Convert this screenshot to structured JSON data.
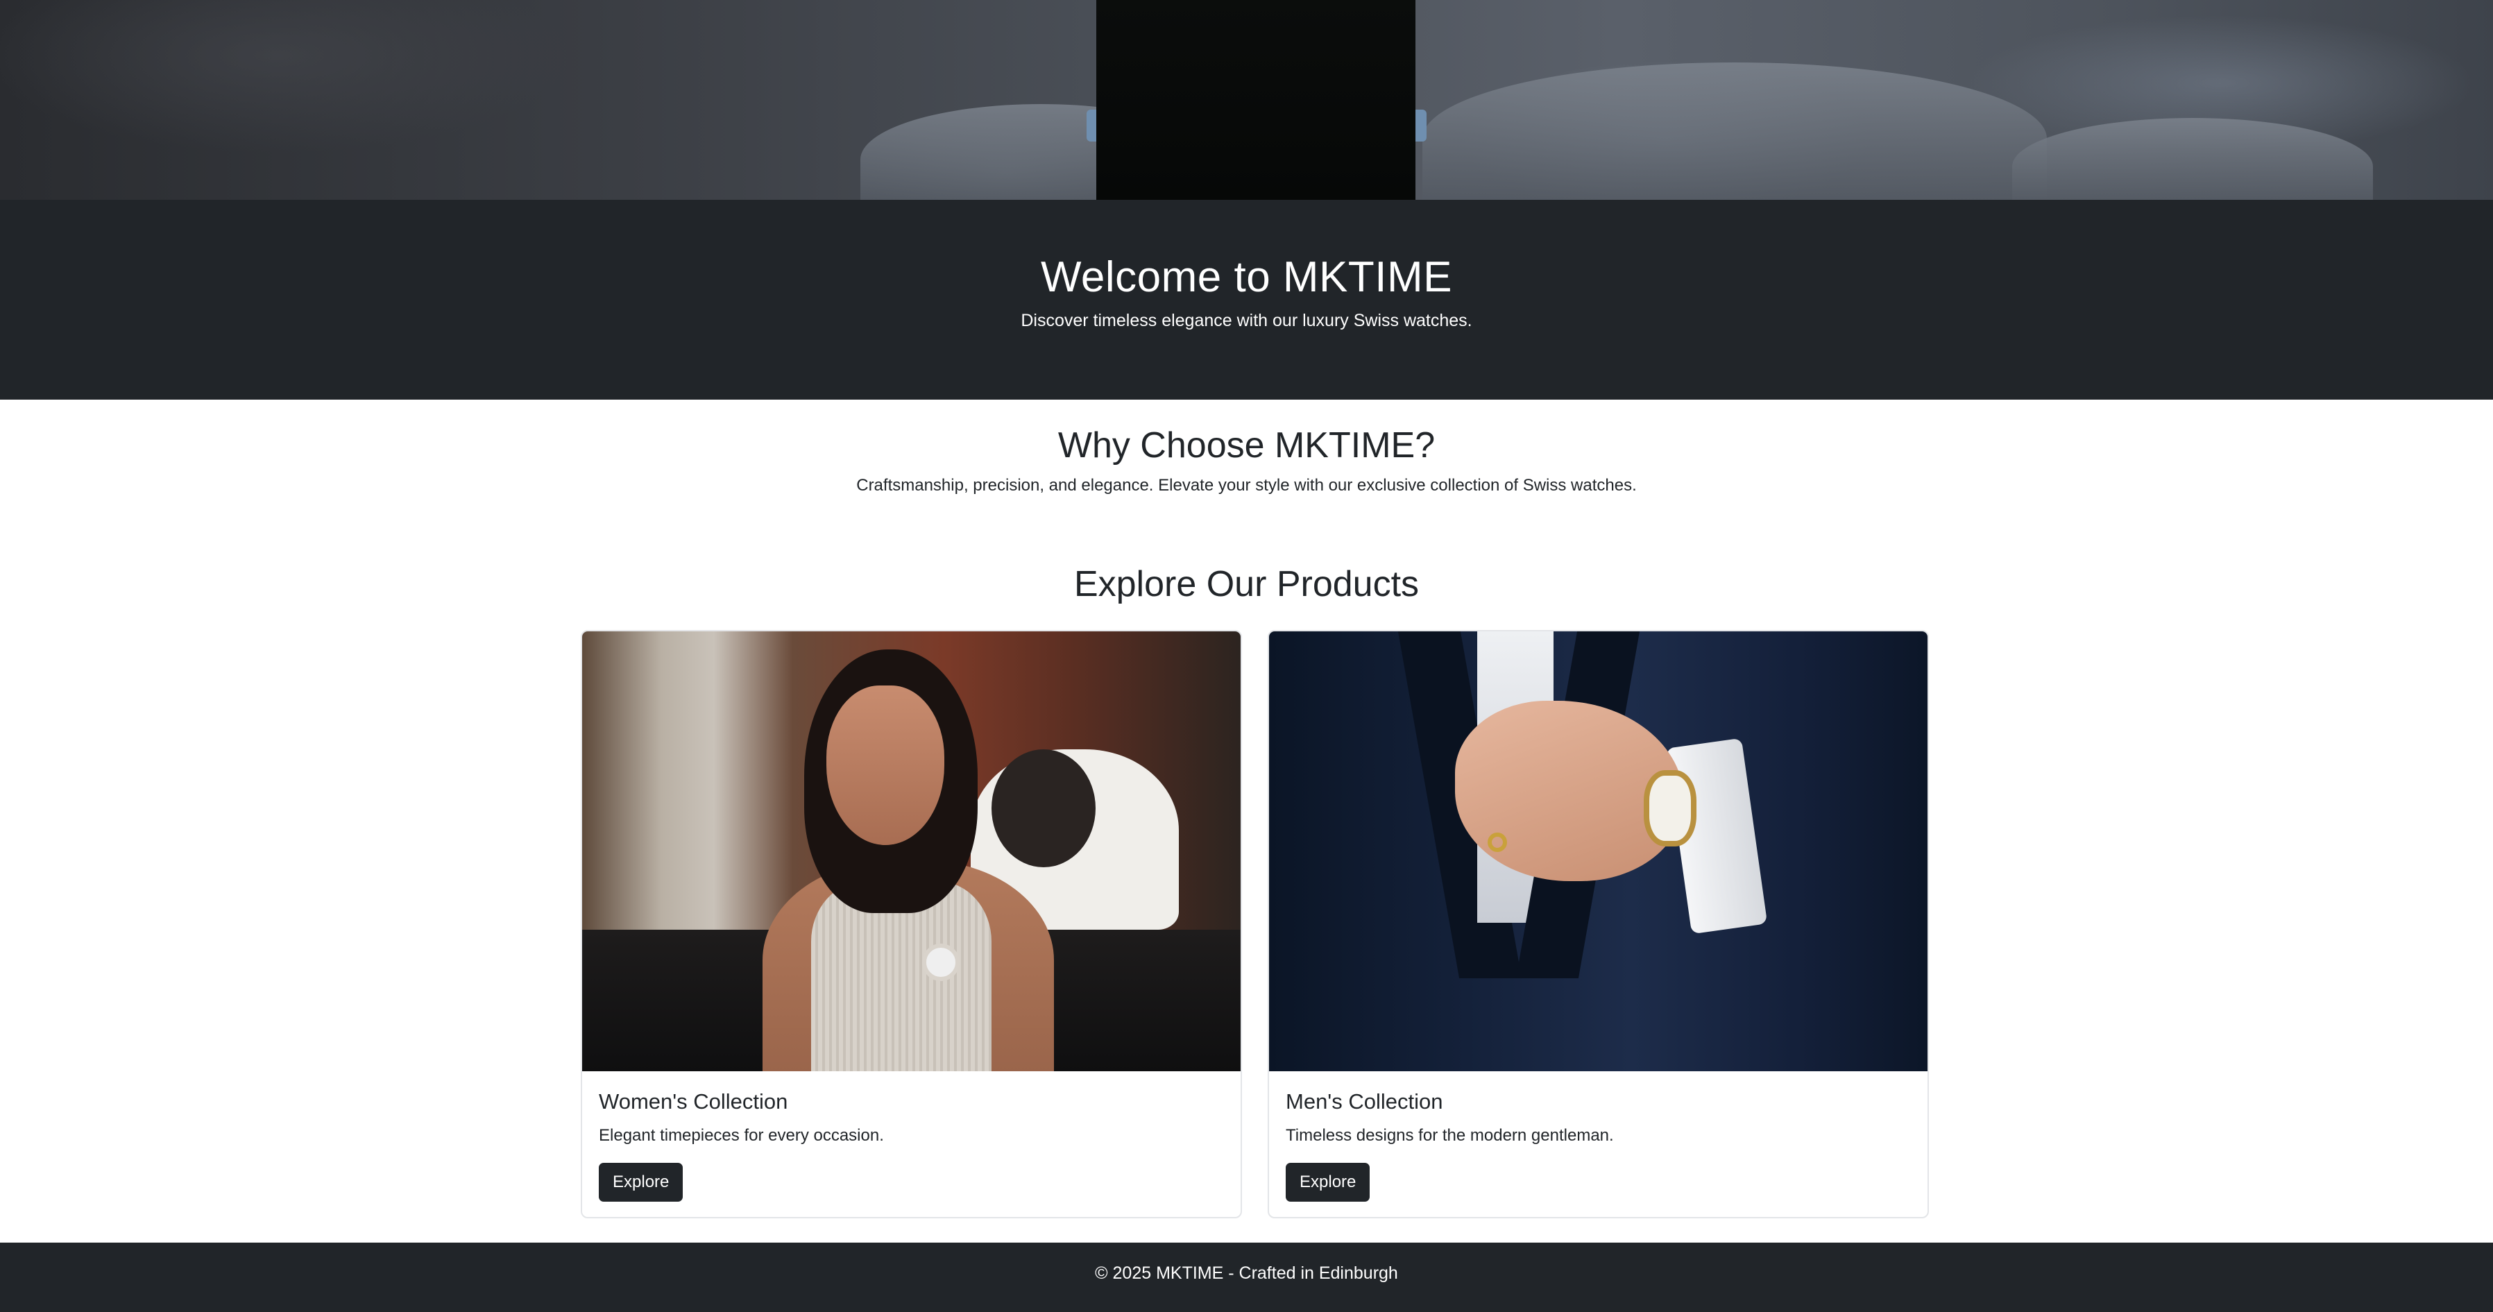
{
  "hero": {
    "title": "Welcome to MKTIME",
    "subtitle": "Discover timeless elegance with our luxury Swiss watches."
  },
  "why": {
    "heading": "Why Choose MKTIME?",
    "text": "Craftsmanship, precision, and elegance. Elevate your style with our exclusive collection of Swiss watches."
  },
  "products": {
    "heading": "Explore Our Products",
    "cards": [
      {
        "title": "Women's Collection",
        "description": "Elegant timepieces for every occasion.",
        "button_label": "Explore"
      },
      {
        "title": "Men's Collection",
        "description": "Timeless designs for the modern gentleman.",
        "button_label": "Explore"
      }
    ]
  },
  "footer": {
    "text": "© 2025 MKTIME - Crafted in Edinburgh"
  },
  "colors": {
    "dark": "#212529",
    "text": "#212529",
    "background": "#ffffff"
  }
}
